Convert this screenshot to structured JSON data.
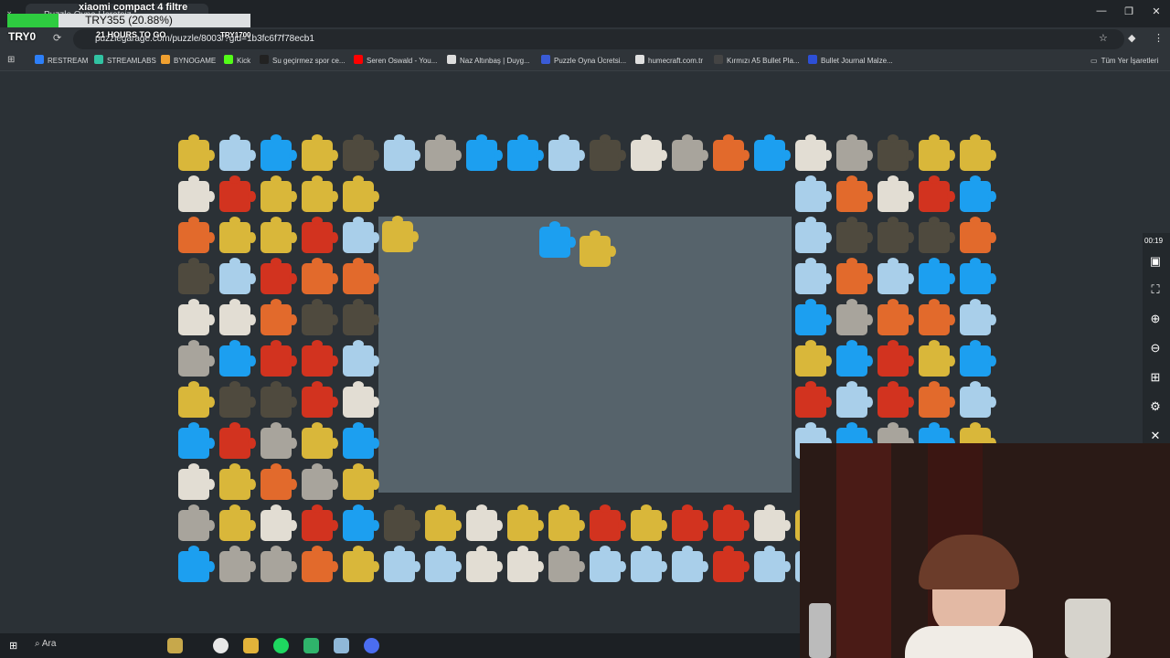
{
  "overlay": {
    "title": "xiaomi compact 4 filtre",
    "progress_text": "TRY355 (20.88%)",
    "progress_fraction": 0.2088,
    "left_label": "TRY0",
    "mid_label": "21 HOURS TO GO",
    "right_label": "TRY1700"
  },
  "browser": {
    "tab_title": "Puzzle Oyna Ücretsiz",
    "url": "puzzlegarage.com/puzzle/8003/?gid=1b3fc6f7f78ecb1",
    "window_controls": [
      "—",
      "❐",
      "✕"
    ]
  },
  "bookmarks": [
    {
      "label": "RESTREAM",
      "color": "#2d7ff9"
    },
    {
      "label": "STREAMLABS",
      "color": "#31c3a2"
    },
    {
      "label": "BYNOGAME",
      "color": "#f0a030"
    },
    {
      "label": "Kick",
      "color": "#53fc18"
    },
    {
      "label": "Su geçirmez spor ce...",
      "color": "#222222"
    },
    {
      "label": "Seren Oswald - You...",
      "color": "#ff0000"
    },
    {
      "label": "Naz Altınbaş | Duyg...",
      "color": "#dddddd"
    },
    {
      "label": "Puzzle Oyna Ücretsi...",
      "color": "#3a5bd6"
    },
    {
      "label": "humecraft.com.tr",
      "color": "#e0e0e0"
    },
    {
      "label": "Kırmızı A5 Bullet Pla...",
      "color": "#444444"
    },
    {
      "label": "Bullet Journal Malze...",
      "color": "#2d4fd6"
    }
  ],
  "bookmarks_all": "Tüm Yer İşaretleri",
  "side_panel": {
    "timer": "00:19",
    "icons": [
      "image-icon",
      "fullscreen-icon",
      "zoom-in-icon",
      "zoom-out-icon",
      "grid-icon",
      "gear-icon",
      "close-icon"
    ]
  },
  "taskbar": {
    "search_label": "Ara"
  }
}
